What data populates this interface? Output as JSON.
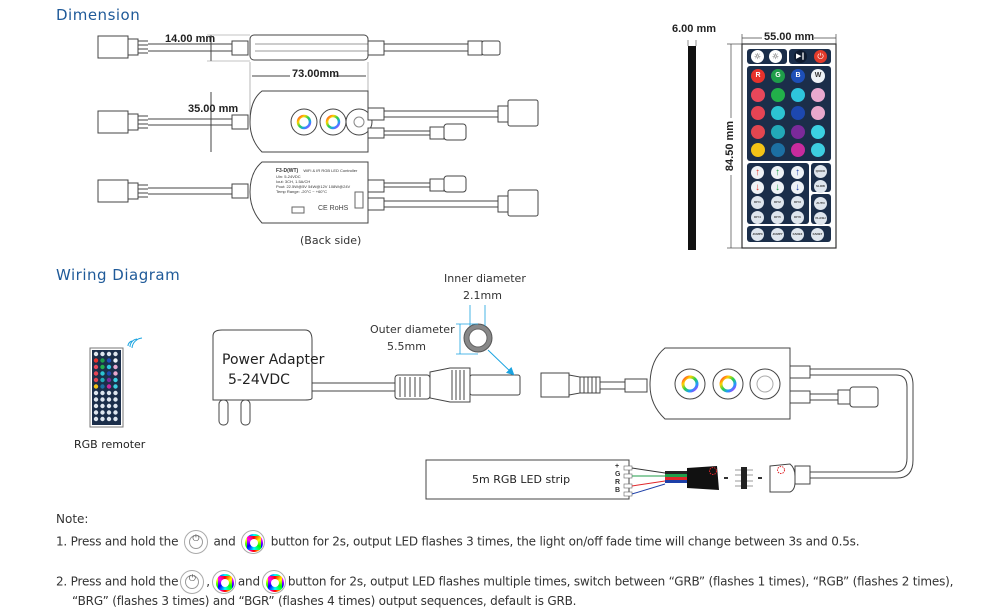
{
  "dimension": {
    "title": "Dimension",
    "height_label": "14.00 mm",
    "length_label": "73.00mm",
    "width_label": "35.00 mm",
    "back_side_caption": "(Back side)",
    "back_label": {
      "model": "F3-D(WT)",
      "subtitle": "WiFi & IR RGB LED Controller",
      "lines": [
        "Uin: 5-24VDC",
        "Iout: 3CH, 1.5A/CH",
        "Pout: 22.5W@5V 54W@12V 108W@24V",
        "Temp Range: -20°C ~ +60°C"
      ],
      "marks": "CE RoHS"
    },
    "remote": {
      "thickness_label": "6.00 mm",
      "width_label": "55.00 mm",
      "height_label": "84.50 mm",
      "top_row": [
        "brightness-up",
        "brightness-down",
        "play-pause",
        "power"
      ],
      "color_rows": [
        [
          {
            "label": "R",
            "color": "#e8322c"
          },
          {
            "label": "G",
            "color": "#1f9e4a"
          },
          {
            "label": "B",
            "color": "#1d4fb8"
          },
          {
            "label": "W",
            "color": "#eef2f6"
          }
        ],
        [
          {
            "label": "",
            "color": "#e8475a"
          },
          {
            "label": "",
            "color": "#22b04a"
          },
          {
            "label": "",
            "color": "#2ec4dd"
          },
          {
            "label": "",
            "color": "#e9a9cf"
          }
        ],
        [
          {
            "label": "",
            "color": "#e54454"
          },
          {
            "label": "",
            "color": "#2cc3d2"
          },
          {
            "label": "",
            "color": "#1d48b0"
          },
          {
            "label": "",
            "color": "#e8a8cc"
          }
        ],
        [
          {
            "label": "",
            "color": "#e24650"
          },
          {
            "label": "",
            "color": "#22a9b8"
          },
          {
            "label": "",
            "color": "#7b2a9a"
          },
          {
            "label": "",
            "color": "#3bd0e2"
          }
        ],
        [
          {
            "label": "",
            "color": "#f3c316"
          },
          {
            "label": "",
            "color": "#1c6fa2"
          },
          {
            "label": "",
            "color": "#c82b9e"
          },
          {
            "label": "",
            "color": "#3dcde0"
          }
        ]
      ],
      "arrow_rows": [
        [
          {
            "dir": "up",
            "color": "#e03a2c"
          },
          {
            "dir": "up",
            "color": "#1f9e4a"
          },
          {
            "dir": "up",
            "color": "#1d3fa8"
          }
        ],
        [
          {
            "dir": "down",
            "color": "#e03a2c"
          },
          {
            "dir": "down",
            "color": "#1f9e4a"
          },
          {
            "dir": "down",
            "color": "#1d3fa8"
          }
        ]
      ],
      "side_buttons": [
        "QUICK",
        "SLOW",
        "AUTO",
        "FLASH"
      ],
      "diy_buttons": [
        "DIY1",
        "DIY2",
        "DIY3",
        "DIY4",
        "DIY5",
        "DIY6"
      ],
      "bottom_buttons": [
        "JUMP3",
        "JUMP7",
        "FADE3",
        "FADE7"
      ]
    }
  },
  "wiring": {
    "title": "Wiring Diagram",
    "inner_diameter_label": "Inner diameter",
    "inner_diameter_value": "2.1mm",
    "outer_diameter_label": "Outer diameter",
    "outer_diameter_value": "5.5mm",
    "adapter_title": "Power Adapter",
    "adapter_voltage": "5-24VDC",
    "remote_caption": "RGB remoter",
    "strip_label": "5m RGB LED strip",
    "pins": [
      "+",
      "G",
      "R",
      "B"
    ],
    "wire_colors": {
      "plus": "#333333",
      "G": "#1f9e4a",
      "R": "#e0262a",
      "B": "#1d3fa8"
    },
    "accent_color": "#1aa3e0"
  },
  "notes": {
    "title": "Note:",
    "note1": {
      "prefix": "1. Press and hold the",
      "and": "and",
      "suffix": "button for 2s, output LED flashes 3 times,  the light on/off fade time will change between 3s and 0.5s."
    },
    "note2": {
      "prefix": "2. Press and hold the",
      "comma": ",",
      "and": "and",
      "suffix": "button for 2s, output LED flashes multiple times, switch between “GRB” (flashes 1 times), “RGB” (flashes 2 times),",
      "line2": "“BRG” (flashes 3 times) and “BGR”  (flashes 4 times) output sequences, default is GRB."
    }
  }
}
